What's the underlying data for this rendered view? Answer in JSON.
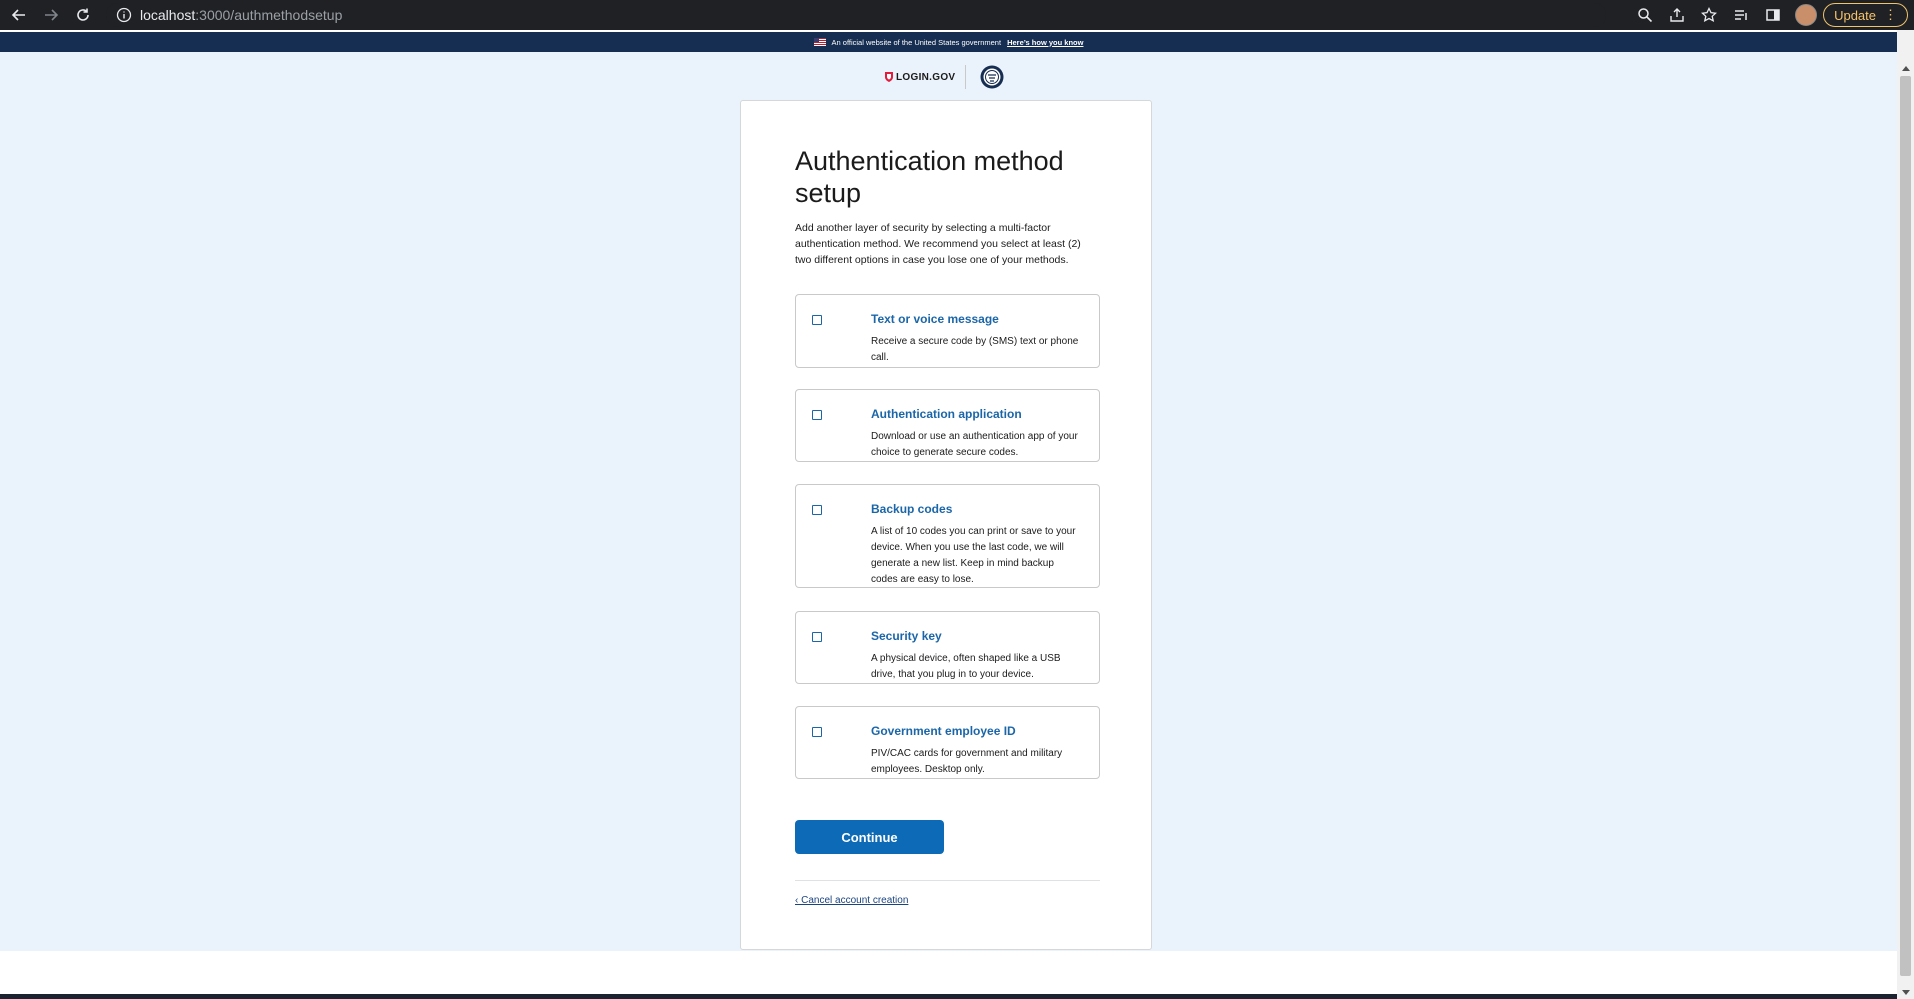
{
  "browser": {
    "url_host": "localhost",
    "url_path": ":3000/authmethodsetup",
    "update_label": "Update"
  },
  "gov_banner": {
    "text": "An official website of the United States government",
    "link": "Here’s how you know"
  },
  "logo": {
    "text": "LOGIN.GOV"
  },
  "main": {
    "title": "Authentication method setup",
    "intro": "Add another layer of security by selecting a multi-factor authentication method. We recommend you select at least (2) two different options in case you lose one of your methods.",
    "options": [
      {
        "title": "Text or voice message",
        "description": "Receive a secure code by (SMS) text or phone call."
      },
      {
        "title": "Authentication application",
        "description": "Download or use an authentication app of your choice to generate secure codes."
      },
      {
        "title": "Backup codes",
        "description": "A list of 10 codes you can print or save to your device. When you use the last code, we will generate a new list. Keep in mind backup codes are easy to lose."
      },
      {
        "title": "Security key",
        "description": "A physical device, often shaped like a USB drive, that you plug in to your device."
      },
      {
        "title": "Government employee ID",
        "description": "PIV/CAC cards for government and military employees. Desktop only."
      }
    ],
    "continue_label": "Continue",
    "cancel_label": "‹ Cancel account creation"
  }
}
